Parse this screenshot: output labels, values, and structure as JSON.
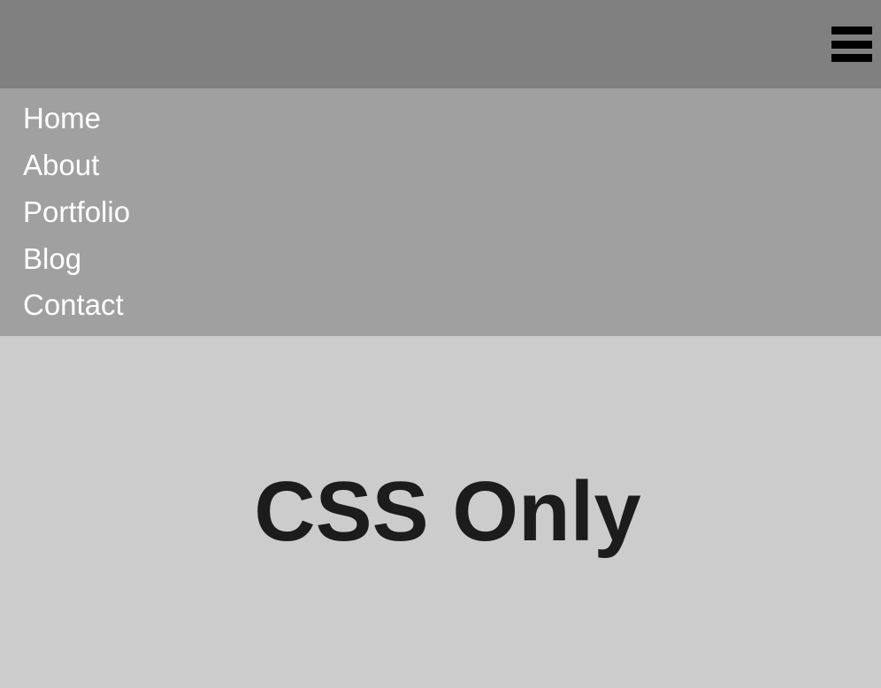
{
  "nav": {
    "items": [
      {
        "label": "Home"
      },
      {
        "label": "About"
      },
      {
        "label": "Portfolio"
      },
      {
        "label": "Blog"
      },
      {
        "label": "Contact"
      }
    ]
  },
  "main": {
    "heading": "CSS Only"
  }
}
